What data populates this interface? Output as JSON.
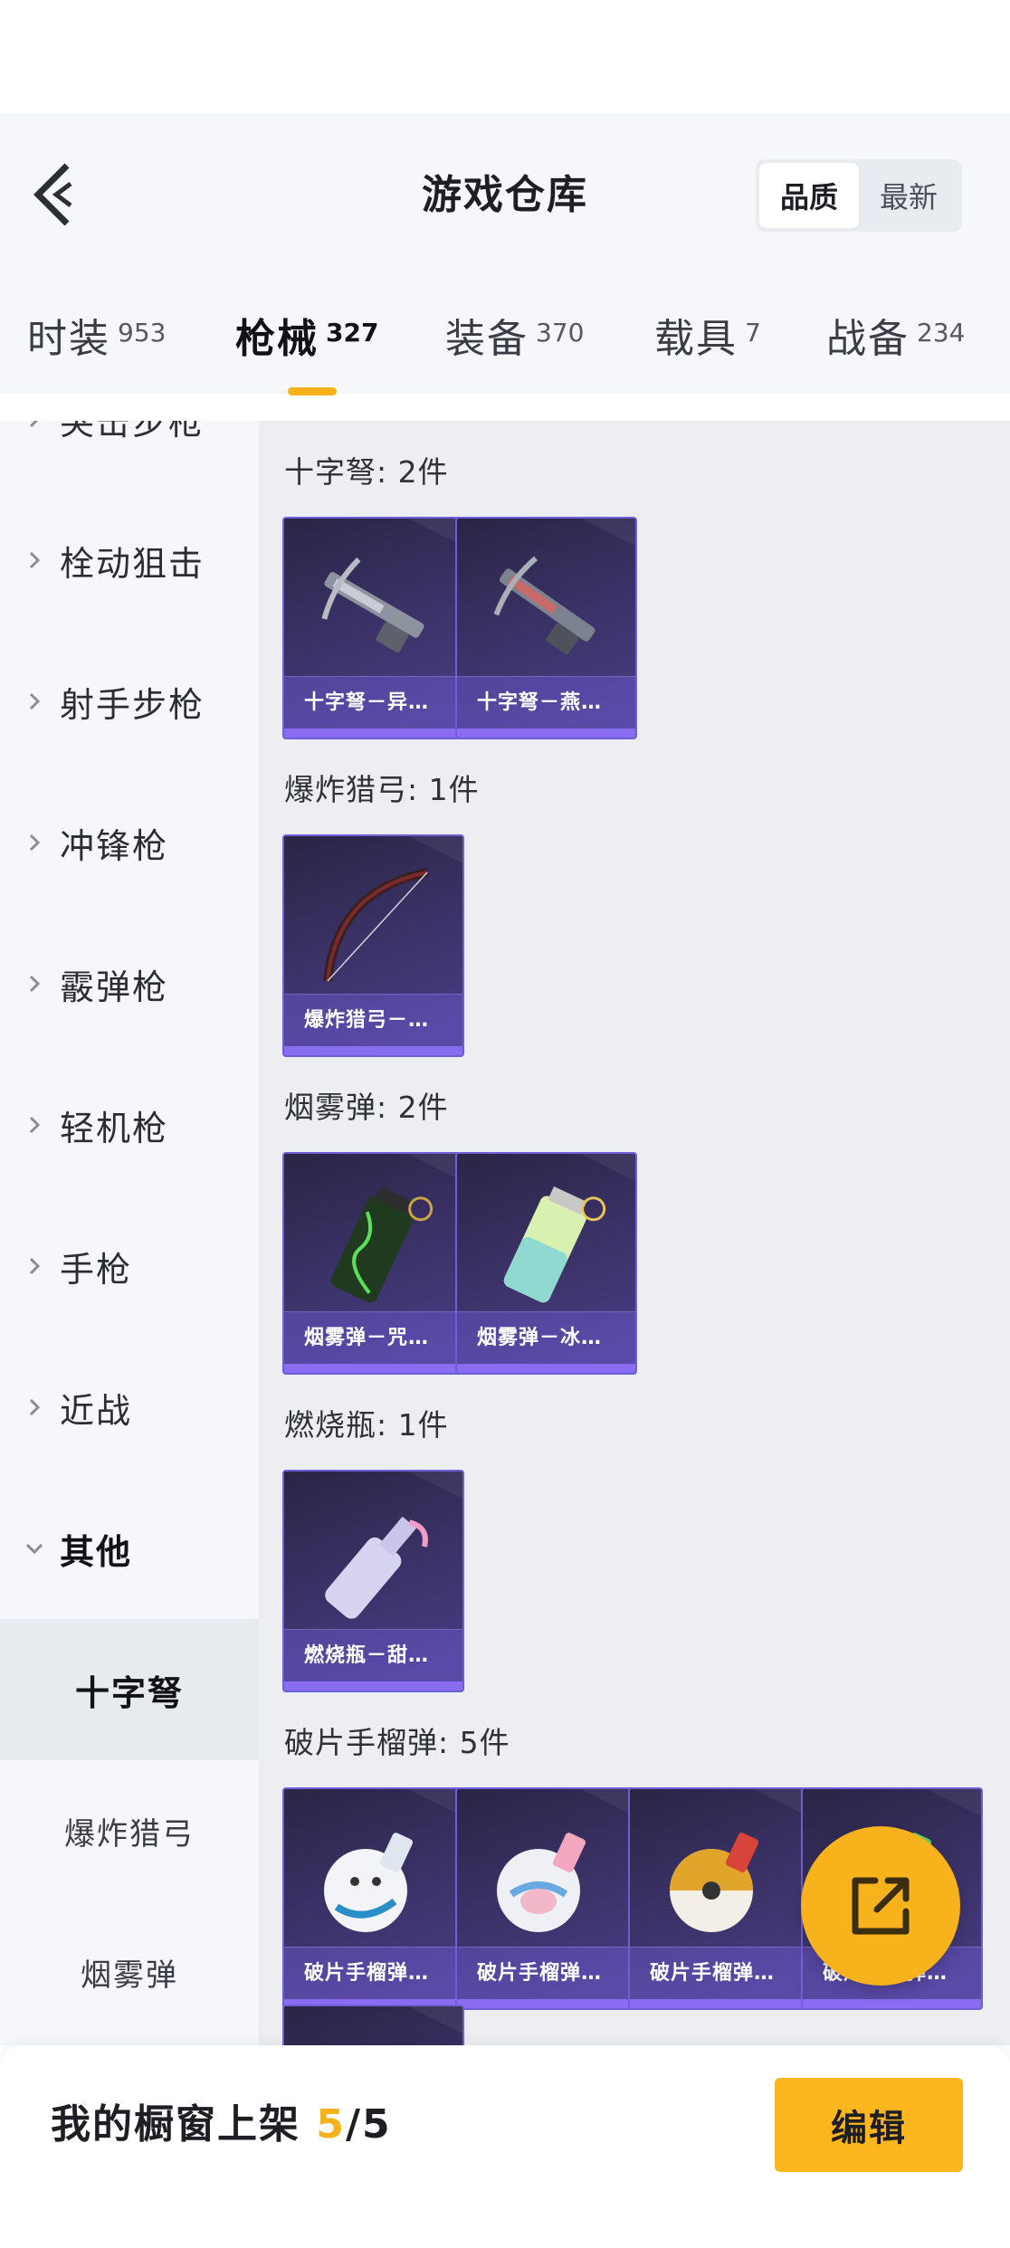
{
  "header": {
    "title": "游戏仓库",
    "sort_options": [
      "品质",
      "最新"
    ],
    "sort_active": "品质"
  },
  "tabs": [
    {
      "label": "时装",
      "count": "953"
    },
    {
      "label": "枪械",
      "count": "327",
      "active": true
    },
    {
      "label": "装备",
      "count": "370"
    },
    {
      "label": "载具",
      "count": "7"
    },
    {
      "label": "战备",
      "count": "234"
    }
  ],
  "sidebar": {
    "items": [
      "突击步枪",
      "栓动狙击",
      "射手步枪",
      "冲锋枪",
      "霰弹枪",
      "轻机枪",
      "手枪",
      "近战",
      "其他"
    ],
    "open_item": "其他",
    "sub_items": [
      "十字弩",
      "爆炸猎弓",
      "烟雾弹"
    ],
    "selected_sub": "十字弩"
  },
  "groups": [
    {
      "title": "十字弩: 2件",
      "items": [
        "十字弩－异…",
        "十字弩－燕…"
      ]
    },
    {
      "title": "爆炸猎弓: 1件",
      "items": [
        "爆炸猎弓－…"
      ]
    },
    {
      "title": "烟雾弹: 2件",
      "items": [
        "烟雾弹－咒…",
        "烟雾弹－冰…"
      ]
    },
    {
      "title": "燃烧瓶: 1件",
      "items": [
        "燃烧瓶－甜…"
      ]
    },
    {
      "title": "破片手榴弹: 5件",
      "items": [
        "破片手榴弹…",
        "破片手榴弹…",
        "破片手榴弹…",
        "破片手榴弹…"
      ]
    }
  ],
  "bottom": {
    "shelf_label": "我的橱窗上架",
    "shelf_current": "5",
    "shelf_total": "/5",
    "edit_label": "编辑"
  },
  "colors": {
    "accent": "#f6b21b",
    "card_border": "#6f5fd6",
    "card_bg": "#3a3165"
  },
  "icons": [
    "back-arrow-icon",
    "chevron-right-icon",
    "chevron-down-icon",
    "share-external-icon"
  ]
}
